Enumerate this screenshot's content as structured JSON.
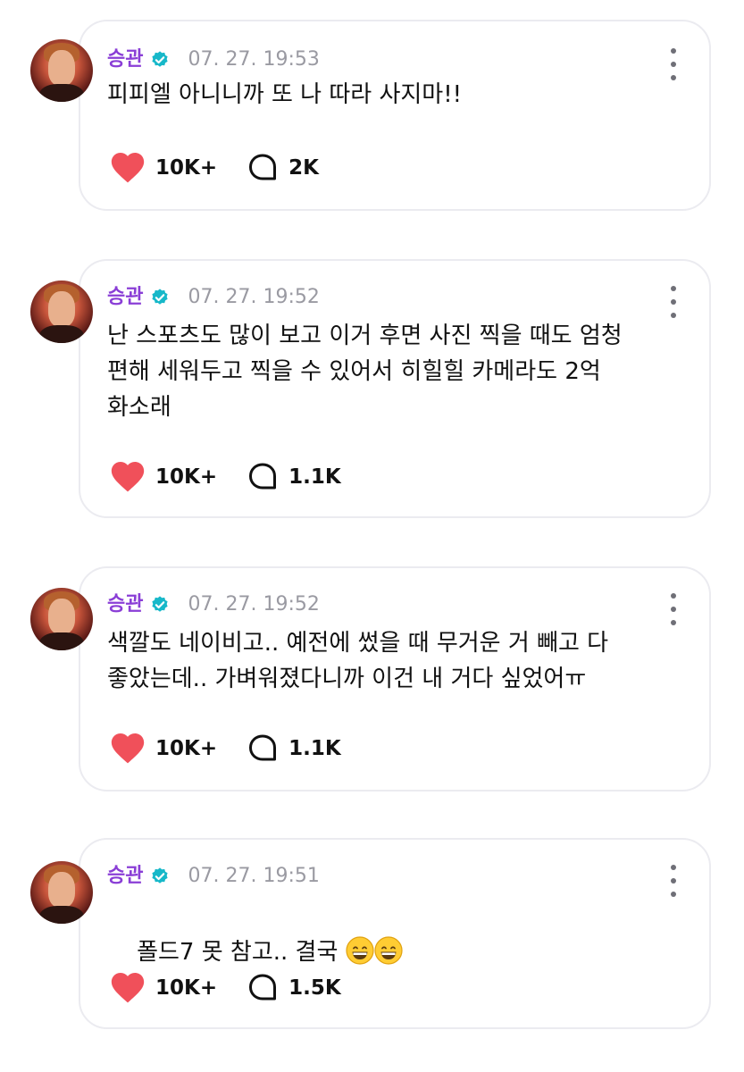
{
  "posts": [
    {
      "username": "승관",
      "time": "07. 27. 19:53",
      "text": "피피엘 아니니까 또 나 따라 사지마!!",
      "likes": "10K+",
      "comments": "2K"
    },
    {
      "username": "승관",
      "time": "07. 27. 19:52",
      "text": "난 스포츠도 많이 보고 이거 후면 사진 찍을 때도 엄청\n편해 세워두고 찍을 수 있어서 히힐힐 카메라도 2억\n화소래",
      "likes": "10K+",
      "comments": "1.1K"
    },
    {
      "username": "승관",
      "time": "07. 27. 19:52",
      "text": "색깔도 네이비고.. 예전에 썼을 때 무거운 거 빼고 다\n좋았는데.. 가벼워졌다니까 이건 내 거다 싶었어ㅠ",
      "likes": "10K+",
      "comments": "1.1K"
    },
    {
      "username": "승관",
      "time": "07. 27. 19:51",
      "text": "폴드7 못 참고.. 결국 ",
      "likes": "10K+",
      "comments": "1.5K"
    }
  ],
  "colors": {
    "username": "#8a3ed6",
    "verified": "#17b8c9",
    "heart": "#f0505a",
    "time": "#9a9aa2",
    "card_border": "#ebebf0"
  },
  "icons": {
    "verified": "verified-badge-icon",
    "more": "more-vertical-icon",
    "like": "heart-icon",
    "comment": "comment-bubble-icon",
    "emoji": "grinning-face-emoji"
  }
}
